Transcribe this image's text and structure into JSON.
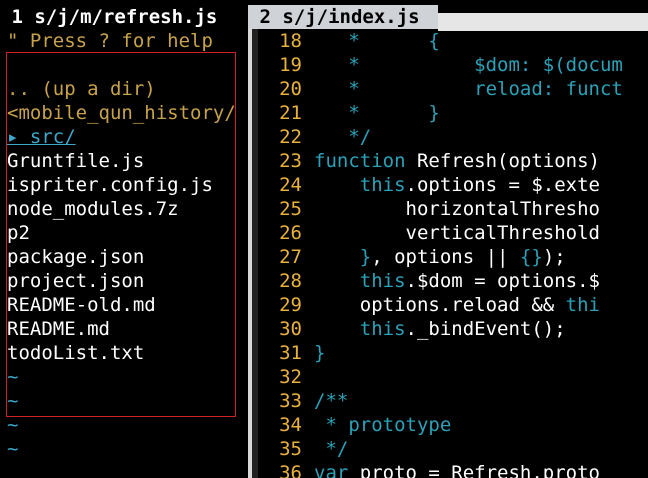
{
  "tabs": [
    {
      "label": " 1 s/j/m/refresh.js "
    },
    {
      "label": " 2 s/j/index.js "
    }
  ],
  "tree": {
    "help": "\" Press ? for help",
    "updir": ".. (up a dir)",
    "root": "<mobile_qun_history/",
    "src": "▸ src/",
    "files": [
      "Gruntfile.js",
      "ispriter.config.js",
      "node_modules.7z",
      "p2",
      "package.json",
      "project.json",
      "README-old.md",
      "README.md",
      "todoList.txt"
    ],
    "tilde": "~"
  },
  "editor": {
    "lines": [
      {
        "n": "18",
        "parts": [
          [
            "cm",
            "   *      {"
          ]
        ]
      },
      {
        "n": "19",
        "parts": [
          [
            "cm",
            "   *          $dom: $(docum"
          ]
        ]
      },
      {
        "n": "20",
        "parts": [
          [
            "cm",
            "   *          reload: funct"
          ]
        ]
      },
      {
        "n": "21",
        "parts": [
          [
            "cm",
            "   *      }"
          ]
        ]
      },
      {
        "n": "22",
        "parts": [
          [
            "cm",
            "   */"
          ]
        ]
      },
      {
        "n": "23",
        "parts": [
          [
            "kw",
            "function"
          ],
          [
            "pl",
            " Refresh(options)"
          ]
        ]
      },
      {
        "n": "24",
        "parts": [
          [
            "pl",
            "    "
          ],
          [
            "kw",
            "this"
          ],
          [
            "pl",
            ".options = $.exte"
          ]
        ]
      },
      {
        "n": "25",
        "parts": [
          [
            "pl",
            "        horizontalThresho"
          ]
        ]
      },
      {
        "n": "26",
        "parts": [
          [
            "pl",
            "        verticalThreshold"
          ]
        ]
      },
      {
        "n": "27",
        "parts": [
          [
            "kw",
            "    }"
          ],
          [
            "pl",
            ", options || "
          ],
          [
            "kw",
            "{}"
          ],
          [
            "pl",
            ");"
          ]
        ]
      },
      {
        "n": "28",
        "parts": [
          [
            "pl",
            "    "
          ],
          [
            "kw",
            "this"
          ],
          [
            "pl",
            ".$dom = options.$"
          ]
        ]
      },
      {
        "n": "29",
        "parts": [
          [
            "pl",
            "    options.reload && "
          ],
          [
            "kw",
            "thi"
          ]
        ]
      },
      {
        "n": "30",
        "parts": [
          [
            "pl",
            "    "
          ],
          [
            "kw",
            "this"
          ],
          [
            "pl",
            "._bindEvent();"
          ]
        ]
      },
      {
        "n": "31",
        "parts": [
          [
            "kw",
            "}"
          ]
        ]
      },
      {
        "n": "32",
        "parts": [
          [
            "pl",
            ""
          ]
        ]
      },
      {
        "n": "33",
        "parts": [
          [
            "cm",
            "/**"
          ]
        ]
      },
      {
        "n": "34",
        "parts": [
          [
            "cm",
            " * prototype"
          ]
        ]
      },
      {
        "n": "35",
        "parts": [
          [
            "cm",
            " */"
          ]
        ]
      },
      {
        "n": "36",
        "parts": [
          [
            "kw",
            "var"
          ],
          [
            "pl",
            " proto = Refresh.proto"
          ]
        ]
      }
    ]
  }
}
